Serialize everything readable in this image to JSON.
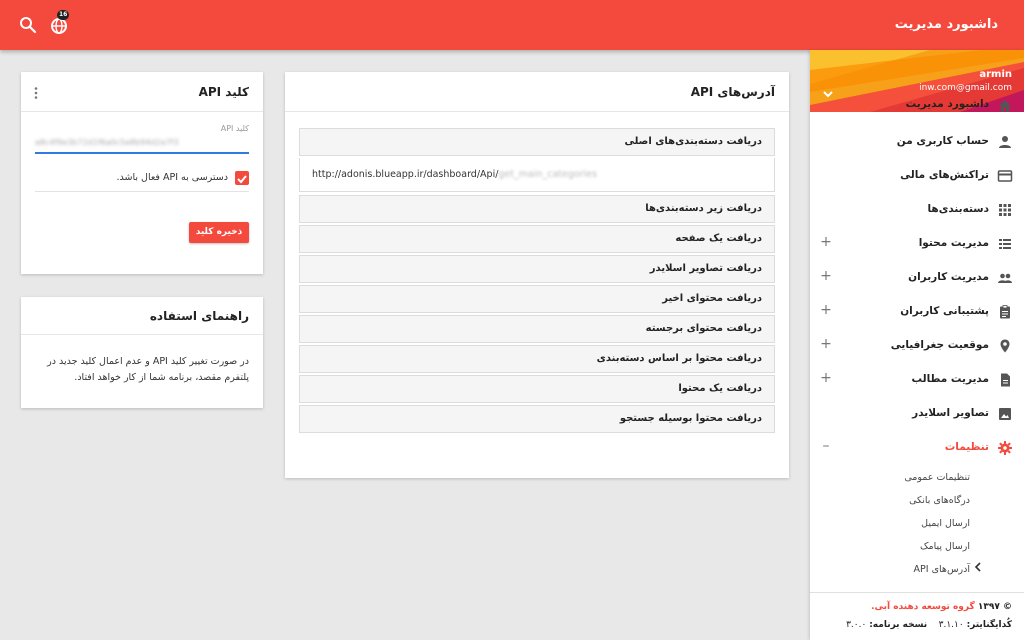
{
  "colors": {
    "primary": "#f44a3e",
    "accent_blue": "#2f7be0"
  },
  "topbar": {
    "title": "داشبورد مدیریت",
    "notification_count": "16",
    "icons": [
      "search-icon",
      "globe-icon"
    ]
  },
  "sidebar": {
    "profile": {
      "name": "armin",
      "email": "inw.com@gmail.com"
    },
    "items": [
      {
        "label": "داشبورد مدیریت",
        "icon": "home-icon",
        "expandable": false
      },
      {
        "label": "حساب کاربری من",
        "icon": "person-icon",
        "expandable": false
      },
      {
        "label": "تراکنش‌های مالی",
        "icon": "credit-card-icon",
        "expandable": false
      },
      {
        "label": "دسته‌بندی‌ها",
        "icon": "grid-icon",
        "expandable": false
      },
      {
        "label": "مدیریت محتوا",
        "icon": "list-icon",
        "expandable": true
      },
      {
        "label": "مدیریت کاربران",
        "icon": "people-icon",
        "expandable": true
      },
      {
        "label": "پشتیبانی کاربران",
        "icon": "clipboard-icon",
        "expandable": true
      },
      {
        "label": "موقعیت جغرافیایی",
        "icon": "location-icon",
        "expandable": true
      },
      {
        "label": "مدیریت مطالب",
        "icon": "file-icon",
        "expandable": true
      },
      {
        "label": "تصاویر اسلایدر",
        "icon": "image-icon",
        "expandable": false
      },
      {
        "label": "تنظیمات",
        "icon": "gear-icon",
        "expandable": true,
        "active": true
      }
    ],
    "plus": "+",
    "minus": "–",
    "settings_sub": [
      "تنظیمات عمومی",
      "درگاه‌های بانکی",
      "ارسال ایمیل",
      "ارسال پیامک",
      "آدرس‌های API"
    ],
    "footer": {
      "copyright_prefix": "© ۱۳۹۷",
      "org": "گروه توسعه دهنده آبی.",
      "codeigniter_label": "کُدایگنایتر:",
      "codeigniter_version": "۳.۱.۱۰",
      "app_version_label": "نسخه برنامه:",
      "app_version": "۳.۰.۰"
    }
  },
  "api_card": {
    "title": "آدرس‌های API",
    "expanded_item": {
      "title": "دریافت دسته‌بندی‌های اصلی",
      "url_visible": "http://adonis.blueapp.ir/dashboard/Api/",
      "url_blurred": "get_main_categories"
    },
    "items": [
      "دریافت زیر دسته‌بندی‌ها",
      "دریافت یک صفحه",
      "دریافت تصاویر اسلایدر",
      "دریافت محتوای اخیر",
      "دریافت محتوای برجسته",
      "دریافت محتوا بر اساس دسته‌بندی",
      "دریافت یک محتوا",
      "دریافت محتوا بوسیله جستجو"
    ]
  },
  "key_card": {
    "title": "کلید API",
    "field_label": "کلید API",
    "field_value": "a8c4f9e3b72d1f6a0c5e8b94d2a7f3",
    "checkbox_label": "دسترسی به API فعال باشد.",
    "checkbox_checked": true,
    "save_label": "ذخیره کلید"
  },
  "help_card": {
    "title": "راهنمای استفاده",
    "text": "در صورت تغییر کلید API و عدم اعمال کلید جدید در پلتفرم مقصد، برنامه شما از کار خواهد افتاد."
  }
}
